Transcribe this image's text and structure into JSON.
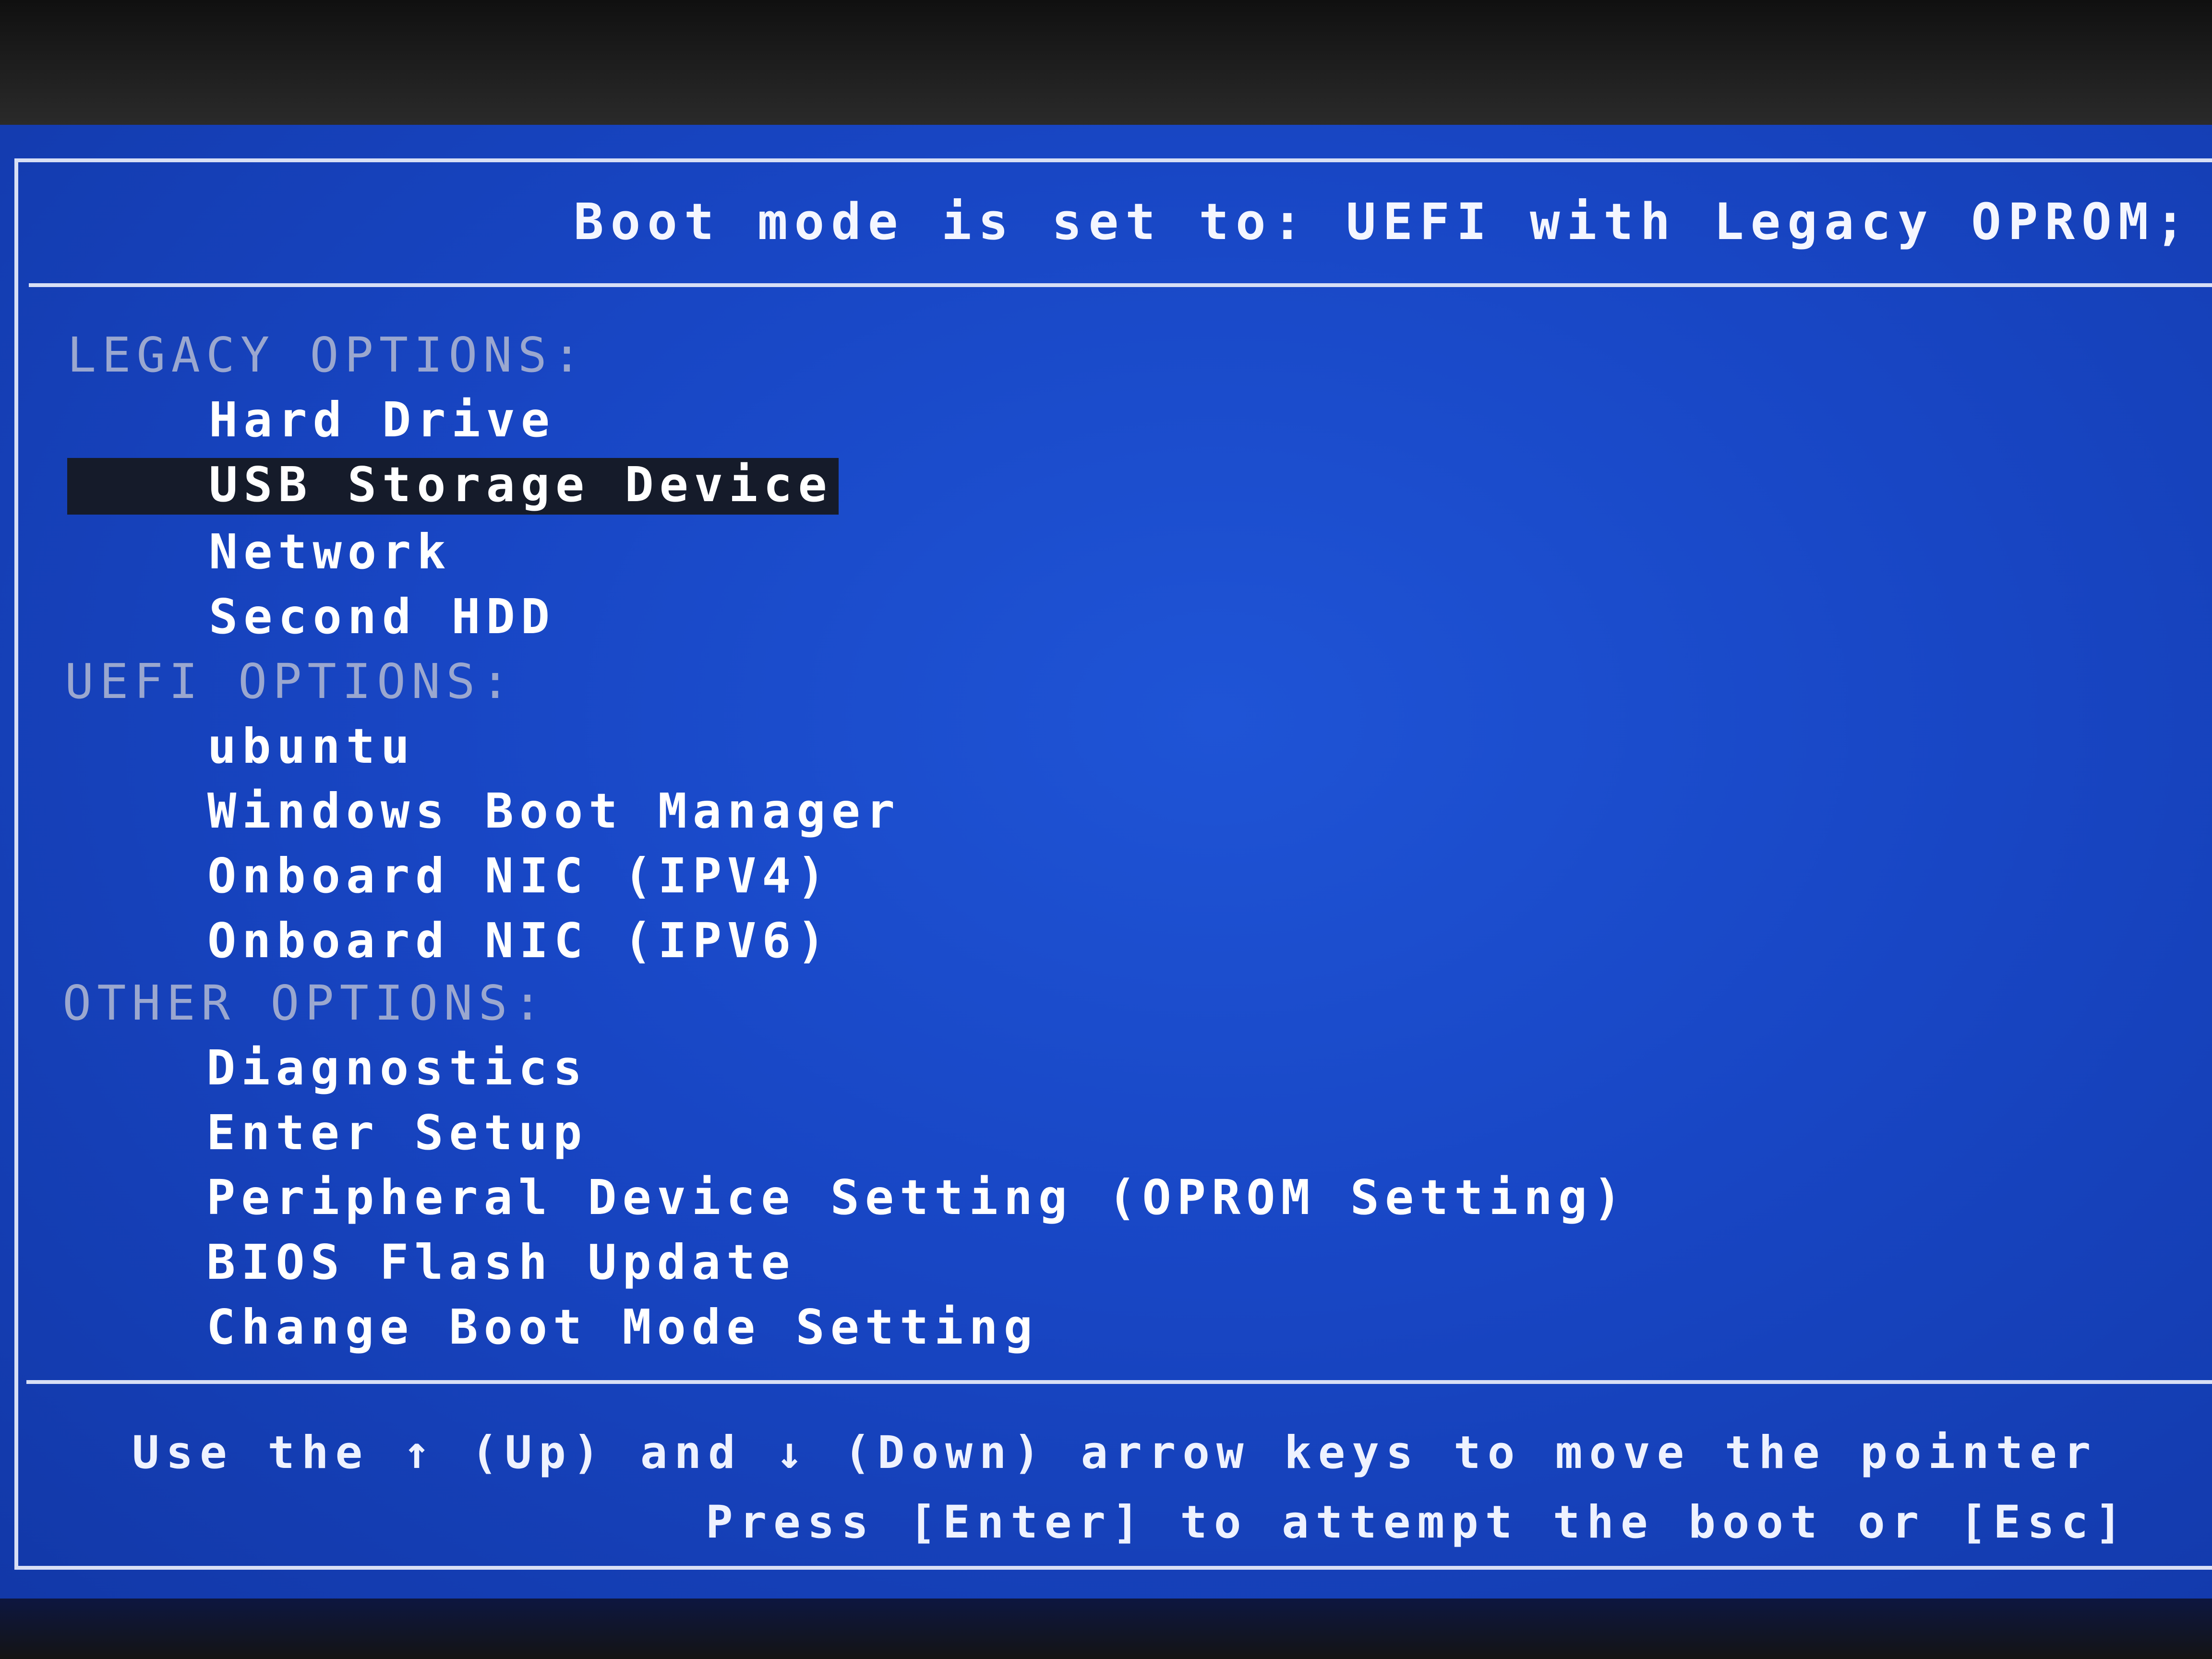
{
  "header": {
    "title": "Boot mode is set to: UEFI with Legacy OPROM; S"
  },
  "boot_menu": {
    "legacy": {
      "heading": "LEGACY OPTIONS:",
      "items": [
        "Hard Drive",
        "USB Storage Device",
        "Network",
        "Second HDD"
      ]
    },
    "uefi": {
      "heading": "UEFI OPTIONS:",
      "items": [
        "ubuntu",
        "Windows Boot Manager",
        "Onboard NIC (IPV4)",
        "Onboard NIC (IPV6)"
      ]
    },
    "other": {
      "heading": "OTHER OPTIONS:",
      "items": [
        "Diagnostics",
        "Enter Setup",
        "Peripheral Device Setting (OPROM Setting)",
        "BIOS Flash Update",
        "Change Boot Mode Setting"
      ]
    },
    "selected_item": "USB Storage Device"
  },
  "footer": {
    "line1": "Use the ↑ (Up) and ↓ (Down) arrow keys to move the pointer",
    "line2": "Press [Enter] to attempt the boot or [Esc]"
  },
  "colors": {
    "screen_background": "#1846c4",
    "highlight_background": "#151b2a",
    "text": "#ffffff",
    "section_heading": "#9aa7cf"
  }
}
